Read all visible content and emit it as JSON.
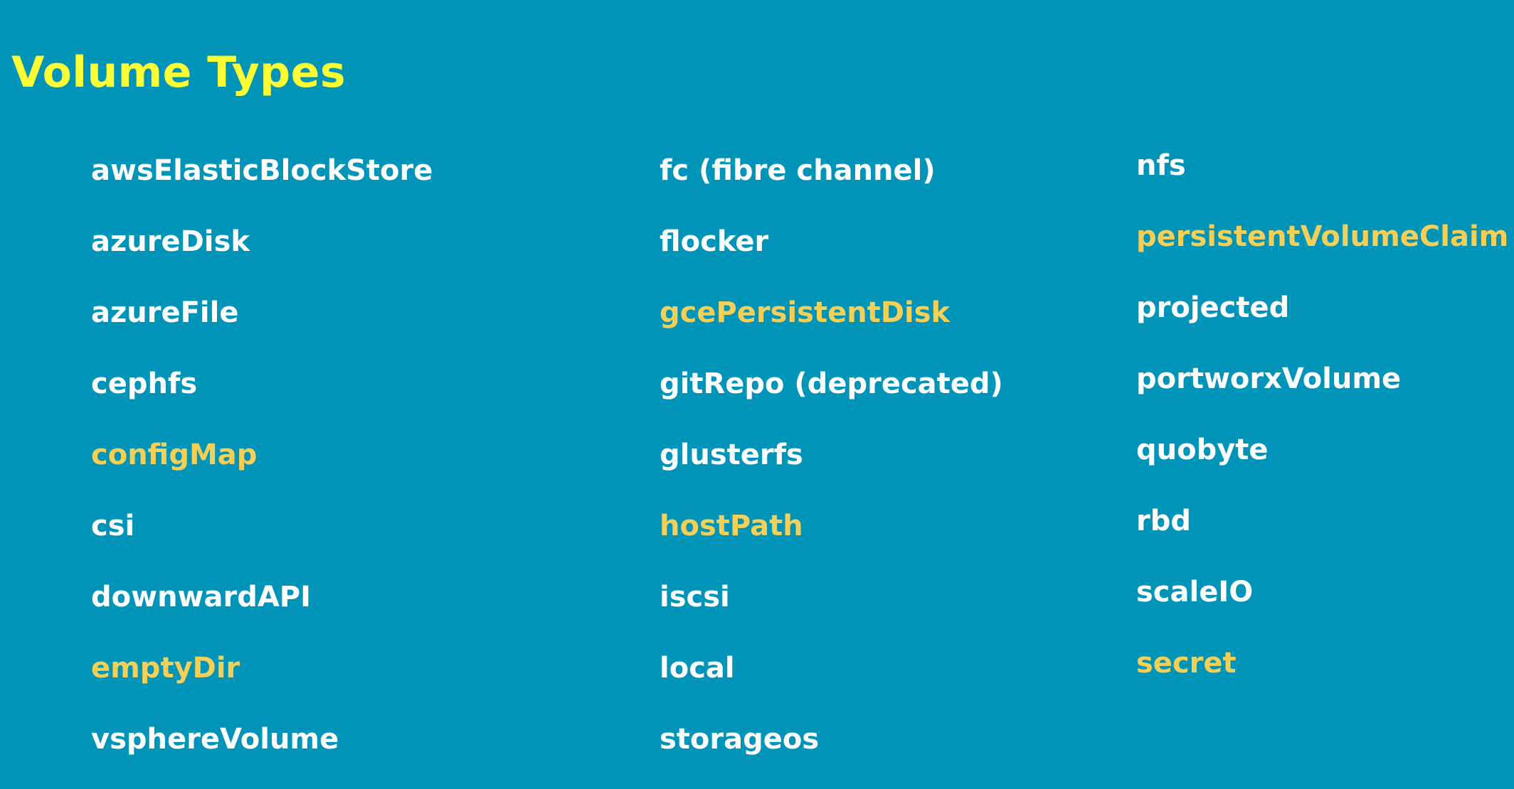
{
  "title": "Volume Types",
  "colors": {
    "background": "#0094b8",
    "title": "#ffff33",
    "text": "#ffffff",
    "highlight": "#f5cf56"
  },
  "columns": [
    {
      "items": [
        {
          "label": "awsElasticBlockStore",
          "highlighted": false
        },
        {
          "label": "azureDisk",
          "highlighted": false
        },
        {
          "label": "azureFile",
          "highlighted": false
        },
        {
          "label": "cephfs",
          "highlighted": false
        },
        {
          "label": "configMap",
          "highlighted": true
        },
        {
          "label": "csi",
          "highlighted": false
        },
        {
          "label": "downwardAPI",
          "highlighted": false
        },
        {
          "label": "emptyDir",
          "highlighted": true
        },
        {
          "label": "vsphereVolume",
          "highlighted": false
        }
      ]
    },
    {
      "items": [
        {
          "label": "fc (fibre channel)",
          "highlighted": false
        },
        {
          "label": "flocker",
          "highlighted": false
        },
        {
          "label": "gcePersistentDisk",
          "highlighted": true
        },
        {
          "label": "gitRepo (deprecated)",
          "highlighted": false
        },
        {
          "label": "glusterfs",
          "highlighted": false
        },
        {
          "label": "hostPath",
          "highlighted": true
        },
        {
          "label": "iscsi",
          "highlighted": false
        },
        {
          "label": "local",
          "highlighted": false
        },
        {
          "label": "storageos",
          "highlighted": false
        }
      ]
    },
    {
      "items": [
        {
          "label": "nfs",
          "highlighted": false
        },
        {
          "label": "persistentVolumeClaim",
          "highlighted": true
        },
        {
          "label": "projected",
          "highlighted": false
        },
        {
          "label": "portworxVolume",
          "highlighted": false
        },
        {
          "label": "quobyte",
          "highlighted": false
        },
        {
          "label": "rbd",
          "highlighted": false
        },
        {
          "label": "scaleIO",
          "highlighted": false
        },
        {
          "label": "secret",
          "highlighted": true
        }
      ]
    }
  ]
}
